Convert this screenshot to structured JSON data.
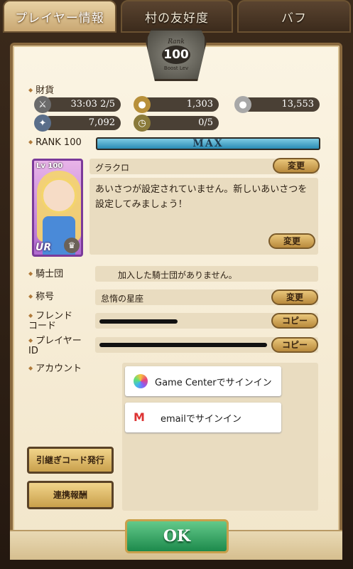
{
  "tabs": [
    {
      "label": "プレイヤー情報"
    },
    {
      "label": "村の友好度"
    },
    {
      "label": "バフ"
    }
  ],
  "rank_badge": {
    "label": "Rank",
    "value": "100",
    "sub": "Boost Lev"
  },
  "assets": {
    "label": "財貨",
    "stamina": "33:03 2/5",
    "gold": "1,303",
    "silver": "13,553",
    "gems": "7,092",
    "keys": "0/5"
  },
  "rank": {
    "label": "RANK 100",
    "bar_text": "MAX",
    "progress": 1.0
  },
  "card": {
    "level": "Lv 100",
    "rarity": "UR"
  },
  "player": {
    "name": "グラクロ",
    "name_change": "変更",
    "greeting": "あいさつが設定されていません。新しいあいさつを設定してみましょう！",
    "greeting_change": "変更"
  },
  "knights": {
    "label": "騎士団",
    "value": "加入した騎士団がありません。"
  },
  "title_row": {
    "label": "称号",
    "value": "怠惰の星座",
    "button": "変更"
  },
  "friend_code": {
    "label": "フレンド\nコード",
    "button": "コピー"
  },
  "player_id": {
    "label": "プレイヤー\nID",
    "button": "コピー"
  },
  "account": {
    "label": "アカウント",
    "game_center": "Game Centerでサインイン",
    "email": "emailでサインイン"
  },
  "buttons": {
    "transfer": "引継ぎコード発行",
    "link_reward": "連携報酬",
    "ok": "OK"
  }
}
